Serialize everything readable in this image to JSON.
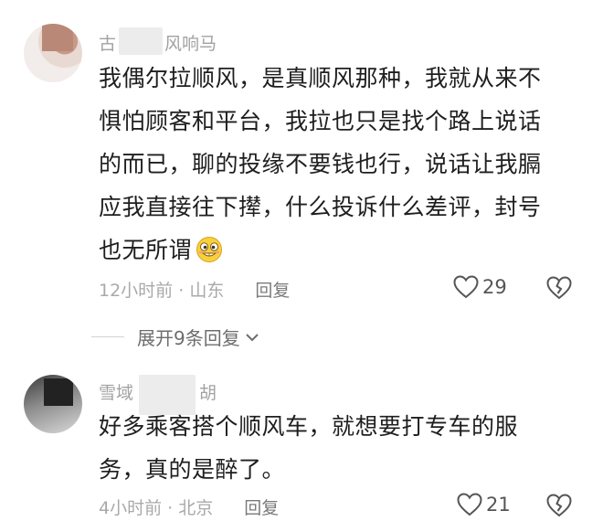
{
  "comments": [
    {
      "username_prefix": "古",
      "username_suffix": "风响马",
      "text_lines": [
        "我偶尔拉顺风，是真顺风那种，我就从来不",
        "惧怕顾客和平台，我拉也只是找个路上说话",
        "的而已，聊的投缘不要钱也行，说话让我膈",
        "应我直接往下撵，什么投诉什么差评，封号",
        "也无所谓"
      ],
      "emoji": "grinning-teeth-emoji",
      "time": "12小时前",
      "location": "山东",
      "reply_label": "回复",
      "likes": "29"
    },
    {
      "username_prefix": "雪域",
      "username_suffix": "胡",
      "text_lines": [
        "好多乘客搭个顺风车，就想要打专车的服",
        "务，真的是醉了。"
      ],
      "time": "4小时前",
      "location": "北京",
      "reply_label": "回复",
      "likes": "21"
    }
  ],
  "expand_replies_label": "展开9条回复",
  "separator": "·"
}
